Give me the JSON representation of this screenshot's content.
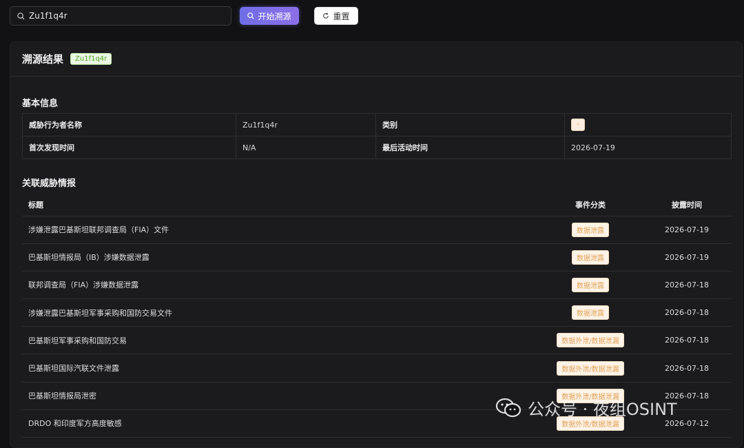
{
  "search": {
    "value": "Zu1f1q4r",
    "start_label": "开始溯源",
    "reset_label": "重置"
  },
  "result": {
    "title": "溯源结果",
    "tag": "Zu1f1q4r",
    "basic": {
      "section_title": "基本信息",
      "actor_label": "威胁行为者名称",
      "actor_value": "Zu1f1q4r",
      "category_label": "类别",
      "category_value": "-",
      "first_seen_label": "首次发现时间",
      "first_seen_value": "N/A",
      "last_active_label": "最后活动时间",
      "last_active_value": "2026-07-19"
    },
    "events": {
      "section_title": "关联威胁情报",
      "headers": {
        "title": "标题",
        "category": "事件分类",
        "time": "披露时间"
      },
      "rows": [
        {
          "title": "涉嫌泄露巴基斯坦联邦调查局（FIA）文件",
          "category": "数据泄露",
          "time": "2026-07-19"
        },
        {
          "title": "巴基斯坦情报局（IB）涉嫌数据泄露",
          "category": "数据泄露",
          "time": "2026-07-19"
        },
        {
          "title": "联邦调查局（FIA）涉嫌数据泄露",
          "category": "数据泄露",
          "time": "2026-07-18"
        },
        {
          "title": "涉嫌泄露巴基斯坦军事采购和国防交易文件",
          "category": "数据泄露",
          "time": "2026-07-18"
        },
        {
          "title": "巴基斯坦军事采购和国防交易",
          "category": "数据外泄/数据泄漏",
          "time": "2026-07-18"
        },
        {
          "title": "巴基斯坦国际汽联文件泄露",
          "category": "数据外泄/数据泄漏",
          "time": "2026-07-18"
        },
        {
          "title": "巴基斯坦情报局泄密",
          "category": "数据外泄/数据泄漏",
          "time": "2026-07-18"
        },
        {
          "title": "DRDO 和印度军方高度敏感",
          "category": "数据外泄/数据泄漏",
          "time": "2026-07-12"
        }
      ]
    }
  },
  "watermark": {
    "text": "公众号 · 夜组OSINT"
  }
}
